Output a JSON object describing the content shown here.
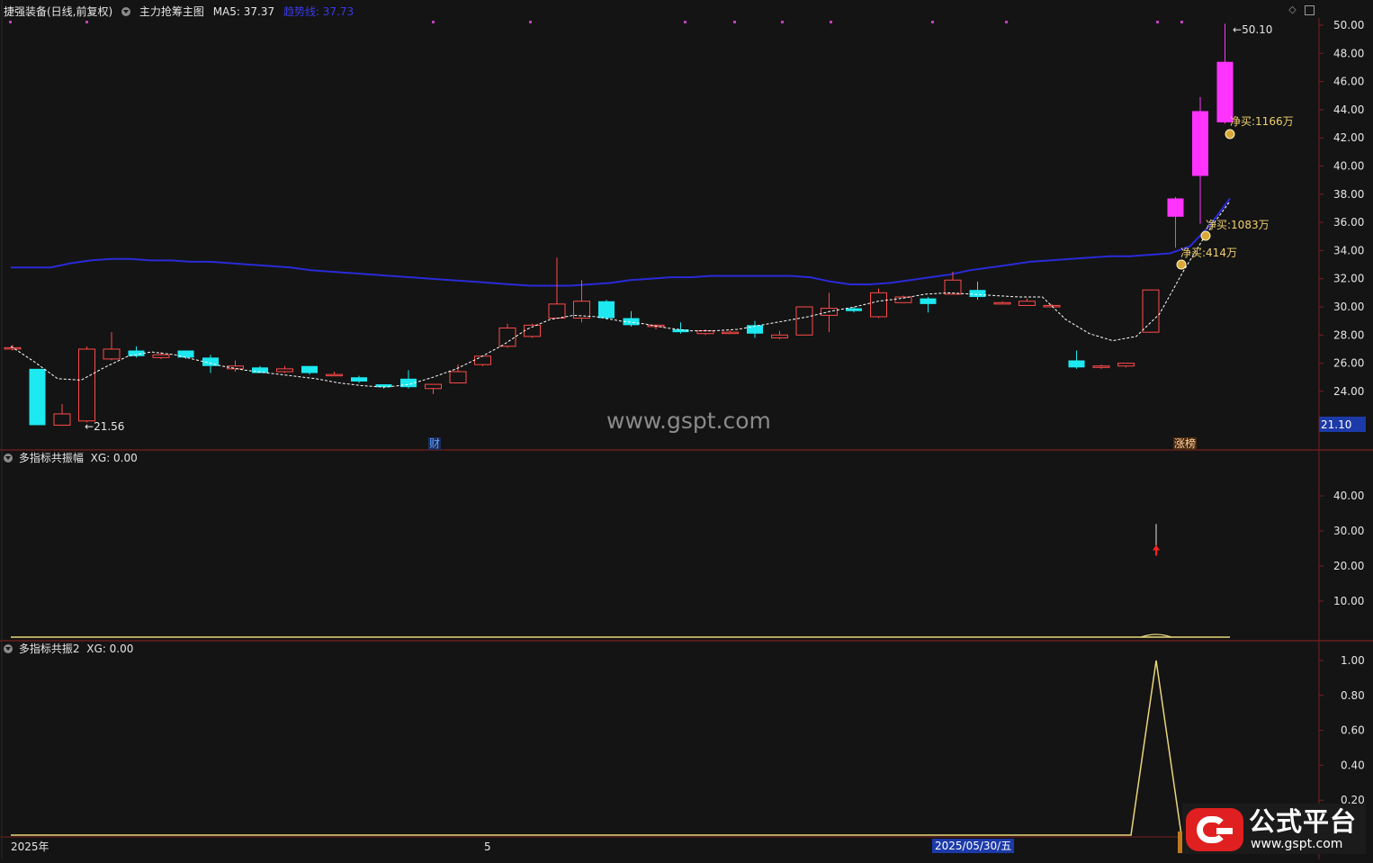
{
  "header": {
    "stock_title": "捷强装备(日线,前复权)",
    "indicator_main": "主力抢筹主图",
    "ma5": "MA5: 37.37",
    "trend_line": "趋势线: 37.73"
  },
  "panel2": {
    "name": "多指标共振幅",
    "value": "XG: 0.00"
  },
  "panel3": {
    "name": "多指标共振2",
    "value": "XG: 0.00"
  },
  "annotations": {
    "high_label": "50.10",
    "low_label": "21.56",
    "price_tag": "21.10",
    "buy1": "净买:414万",
    "buy2": "净买:1083万",
    "buy3": "净买:1166万",
    "fin_marker": "财",
    "zhangbang_marker": "涨榜",
    "watermark": "www.gspt.com"
  },
  "x_axis": {
    "start": "2025年",
    "mid": "5",
    "cursor_date": "2025/05/30/五"
  },
  "logo": {
    "title": "公式平台",
    "url": "www.gspt.com"
  },
  "colors": {
    "up": "#ff4a4a",
    "down": "#1de9f0",
    "limit": "#ff33ff",
    "ma_line": "#2a2ad8",
    "trend": "#ffffff",
    "axis": "#7a1e1e",
    "osc": "#e8d67a",
    "purple_dot": "#c040c0"
  },
  "chart_data": [
    {
      "type": "candlestick",
      "title": "捷强装备(日线,前复权)",
      "ylim": [
        21.1,
        50.1
      ],
      "yticks": [
        24,
        26,
        28,
        30,
        32,
        34,
        36,
        38,
        40,
        42,
        44,
        46,
        48,
        50
      ],
      "candles": [
        {
          "o": 27.1,
          "h": 27.3,
          "l": 26.9,
          "c": 27.1
        },
        {
          "o": 25.6,
          "h": 25.6,
          "l": 21.6,
          "c": 21.6
        },
        {
          "o": 21.6,
          "h": 23.1,
          "l": 21.6,
          "c": 22.4
        },
        {
          "o": 21.9,
          "h": 27.2,
          "l": 21.8,
          "c": 27.0
        },
        {
          "o": 26.3,
          "h": 28.2,
          "l": 26.2,
          "c": 27.0
        },
        {
          "o": 26.9,
          "h": 27.2,
          "l": 26.4,
          "c": 26.5
        },
        {
          "o": 26.4,
          "h": 26.8,
          "l": 26.3,
          "c": 26.6
        },
        {
          "o": 26.9,
          "h": 26.9,
          "l": 26.3,
          "c": 26.4
        },
        {
          "o": 26.4,
          "h": 26.6,
          "l": 25.3,
          "c": 25.8
        },
        {
          "o": 25.6,
          "h": 26.2,
          "l": 25.4,
          "c": 25.8
        },
        {
          "o": 25.7,
          "h": 25.8,
          "l": 25.3,
          "c": 25.3
        },
        {
          "o": 25.4,
          "h": 25.8,
          "l": 25.3,
          "c": 25.6
        },
        {
          "o": 25.8,
          "h": 25.8,
          "l": 25.2,
          "c": 25.3
        },
        {
          "o": 25.2,
          "h": 25.4,
          "l": 25.1,
          "c": 25.2
        },
        {
          "o": 25.0,
          "h": 25.1,
          "l": 24.6,
          "c": 24.7
        },
        {
          "o": 24.5,
          "h": 24.5,
          "l": 24.2,
          "c": 24.3
        },
        {
          "o": 24.9,
          "h": 25.5,
          "l": 24.2,
          "c": 24.3
        },
        {
          "o": 24.2,
          "h": 24.5,
          "l": 23.8,
          "c": 24.5
        },
        {
          "o": 24.6,
          "h": 25.9,
          "l": 24.6,
          "c": 25.4
        },
        {
          "o": 25.9,
          "h": 26.5,
          "l": 25.8,
          "c": 26.5
        },
        {
          "o": 27.2,
          "h": 28.8,
          "l": 27.1,
          "c": 28.5
        },
        {
          "o": 27.9,
          "h": 28.8,
          "l": 27.8,
          "c": 28.7
        },
        {
          "o": 29.2,
          "h": 33.5,
          "l": 29.2,
          "c": 30.2
        },
        {
          "o": 29.2,
          "h": 31.9,
          "l": 28.9,
          "c": 30.4
        },
        {
          "o": 30.4,
          "h": 30.5,
          "l": 29.1,
          "c": 29.2
        },
        {
          "o": 29.2,
          "h": 29.7,
          "l": 28.6,
          "c": 28.7
        },
        {
          "o": 28.6,
          "h": 28.7,
          "l": 28.4,
          "c": 28.7
        },
        {
          "o": 28.4,
          "h": 28.9,
          "l": 28.1,
          "c": 28.2
        },
        {
          "o": 28.1,
          "h": 28.4,
          "l": 28.0,
          "c": 28.3
        },
        {
          "o": 28.2,
          "h": 28.3,
          "l": 28.1,
          "c": 28.2
        },
        {
          "o": 28.7,
          "h": 29.0,
          "l": 27.8,
          "c": 28.1
        },
        {
          "o": 27.8,
          "h": 28.3,
          "l": 27.7,
          "c": 28.0
        },
        {
          "o": 28.0,
          "h": 30.0,
          "l": 28.0,
          "c": 30.0
        },
        {
          "o": 29.4,
          "h": 31.0,
          "l": 28.2,
          "c": 29.9
        },
        {
          "o": 29.9,
          "h": 30.0,
          "l": 29.6,
          "c": 29.7
        },
        {
          "o": 29.3,
          "h": 31.3,
          "l": 29.2,
          "c": 31.0
        },
        {
          "o": 30.3,
          "h": 30.8,
          "l": 30.3,
          "c": 30.7
        },
        {
          "o": 30.6,
          "h": 30.7,
          "l": 29.6,
          "c": 30.2
        },
        {
          "o": 30.9,
          "h": 32.5,
          "l": 30.9,
          "c": 31.9
        },
        {
          "o": 31.2,
          "h": 31.8,
          "l": 30.5,
          "c": 30.7
        },
        {
          "o": 30.2,
          "h": 30.4,
          "l": 30.2,
          "c": 30.3
        },
        {
          "o": 30.1,
          "h": 30.6,
          "l": 30.1,
          "c": 30.4
        },
        {
          "o": 30.0,
          "h": 30.2,
          "l": 30.0,
          "c": 30.1
        },
        {
          "o": 26.2,
          "h": 26.9,
          "l": 25.6,
          "c": 25.7
        },
        {
          "o": 25.7,
          "h": 25.9,
          "l": 25.6,
          "c": 25.8
        },
        {
          "o": 25.8,
          "h": 26.0,
          "l": 25.7,
          "c": 26.0
        },
        {
          "o": 28.2,
          "h": 31.2,
          "l": 28.2,
          "c": 31.2
        },
        {
          "o": 36.4,
          "h": 37.8,
          "l": 34.2,
          "c": 37.7
        },
        {
          "o": 39.3,
          "h": 44.9,
          "l": 35.9,
          "c": 43.9
        },
        {
          "o": 43.1,
          "h": 50.1,
          "l": 43.0,
          "c": 47.4
        }
      ],
      "ma_line": [
        32.8,
        32.8,
        32.8,
        33.1,
        33.3,
        33.4,
        33.4,
        33.3,
        33.3,
        33.2,
        33.2,
        33.1,
        33.0,
        32.9,
        32.8,
        32.6,
        32.5,
        32.4,
        32.3,
        32.2,
        32.1,
        32.0,
        31.9,
        31.8,
        31.7,
        31.6,
        31.5,
        31.5,
        31.5,
        31.6,
        31.7,
        31.9,
        32.0,
        32.1,
        32.1,
        32.2,
        32.2,
        32.2,
        32.2,
        32.2,
        32.1,
        31.8,
        31.6,
        31.6,
        31.7,
        31.9,
        32.1,
        32.3,
        32.6,
        32.8,
        33.0,
        33.2,
        33.3,
        33.4,
        33.5,
        33.6,
        33.6,
        33.7,
        33.8,
        34.3,
        35.8,
        37.7
      ],
      "trend_line": [
        27.2,
        26.1,
        24.9,
        24.8,
        25.7,
        26.5,
        26.8,
        26.6,
        26.2,
        25.8,
        25.5,
        25.3,
        25.1,
        24.9,
        24.6,
        24.4,
        24.3,
        24.5,
        25.0,
        25.6,
        26.4,
        27.3,
        28.4,
        29.1,
        29.4,
        29.3,
        29.0,
        28.8,
        28.5,
        28.3,
        28.3,
        28.4,
        28.7,
        29.0,
        29.3,
        29.7,
        30.0,
        30.4,
        30.6,
        30.9,
        31.0,
        30.9,
        30.8,
        30.7,
        30.7,
        29.1,
        28.1,
        27.6,
        27.9,
        29.5,
        32.5,
        35.2,
        37.5
      ]
    },
    {
      "type": "bar",
      "title": "多指标共振幅",
      "ylim": [
        0,
        50
      ],
      "yticks": [
        10,
        20,
        30,
        40
      ],
      "signal_bar": {
        "index": 46,
        "value": 32,
        "marker": 25
      },
      "baseline": 0
    },
    {
      "type": "line",
      "title": "多指标共振2",
      "ylim": [
        0,
        1.07
      ],
      "yticks": [
        0.2,
        0.4,
        0.6,
        0.8,
        1.0
      ],
      "peak": {
        "index": 46,
        "value": 1.0
      }
    }
  ]
}
